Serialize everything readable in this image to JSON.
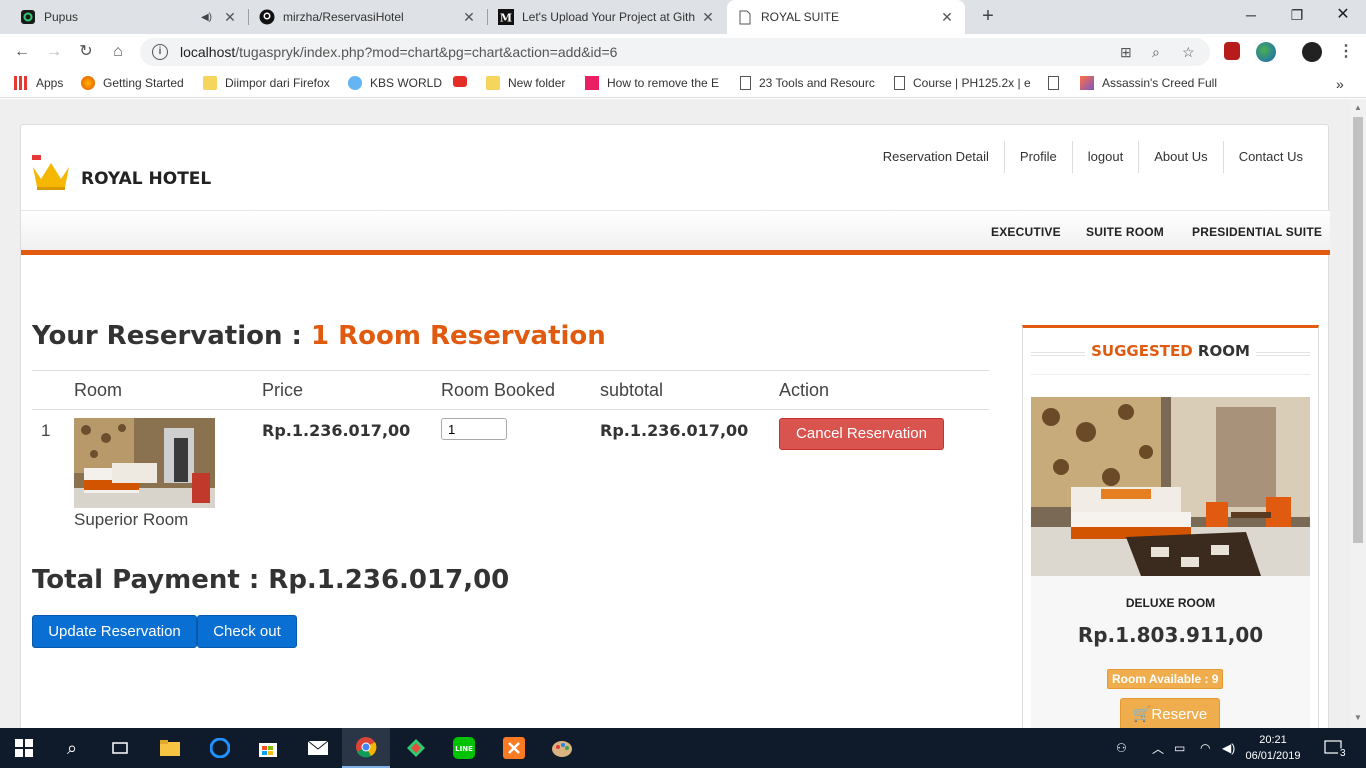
{
  "browser": {
    "tabs": [
      {
        "title": "Pupus",
        "icon": "app-icon"
      },
      {
        "title": "mirzha/ReservasiHotel",
        "icon": "github-icon"
      },
      {
        "title": "Let's Upload Your Project at Gith",
        "icon": "medium-icon"
      },
      {
        "title": "ROYAL SUITE",
        "icon": "page-icon"
      }
    ],
    "url_host": "localhost",
    "url_path": "/tugaspryk/index.php?mod=chart&pg=chart&action=add&id=6",
    "bookmarks": [
      "Apps",
      "Getting Started",
      "Diimpor dari Firefox",
      "KBS WORLD",
      "",
      "New folder",
      "How to remove the E",
      "23 Tools and Resourc",
      "Course | PH125.2x | e",
      "Assassin's Creed Full"
    ]
  },
  "site": {
    "brand": "ROYAL HOTEL",
    "top_nav": [
      "Reservation Detail",
      "Profile",
      "logout",
      "About Us",
      "Contact Us"
    ],
    "main_nav": [
      "EXECUTIVE",
      "SUITE ROOM",
      "PRESIDENTIAL SUITE"
    ]
  },
  "reservation": {
    "title_prefix": "Your Reservation : ",
    "title_highlight": "1 Room Reservation",
    "columns": [
      "Room",
      "Price",
      "Room Booked",
      "subtotal",
      "Action"
    ],
    "rows": [
      {
        "no": "1",
        "room": "Superior Room",
        "price": "Rp.1.236.017,00",
        "booked": "1",
        "subtotal": "Rp.1.236.017,00",
        "action": "Cancel Reservation"
      }
    ],
    "total_label": "Total Payment : Rp.1.236.017,00",
    "update_button": "Update Reservation",
    "checkout_button": "Check out"
  },
  "suggested": {
    "heading_highlight": "SUGGESTED",
    "heading_rest": "ROOM",
    "room_name": "DELUXE ROOM",
    "price": "Rp.1.803.911,00",
    "availability": "Room Available : 9",
    "reserve_button": "Reserve"
  },
  "taskbar": {
    "time": "20:21",
    "date": "06/01/2019",
    "notifications": "3"
  },
  "colors": {
    "accent": "#e05a0f",
    "danger": "#d9534f",
    "primary": "#0a6fd2",
    "warning": "#f0ad4e"
  }
}
